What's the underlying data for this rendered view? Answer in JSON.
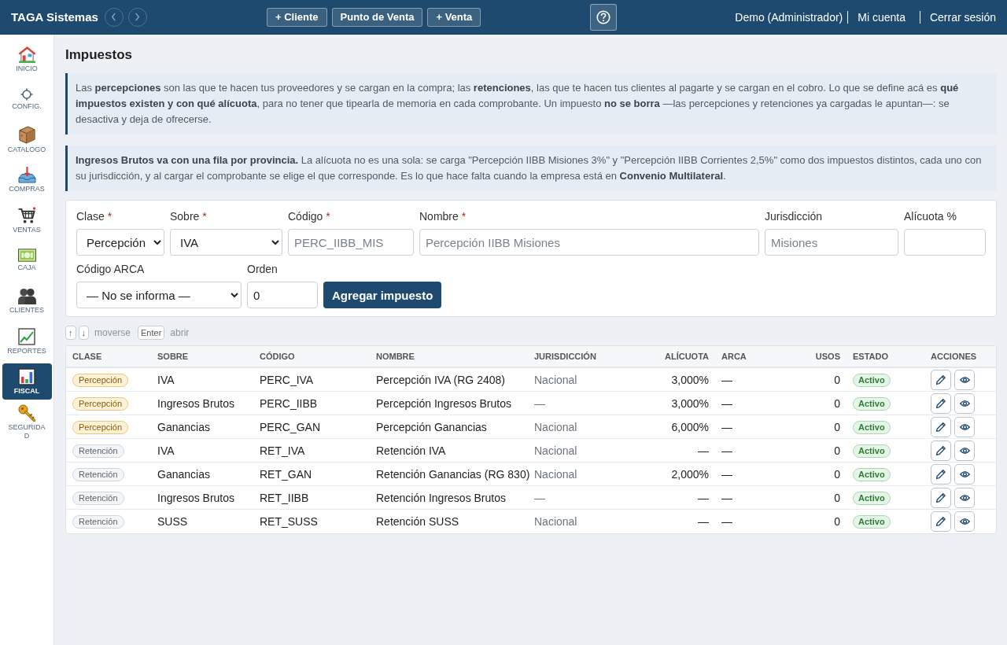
{
  "top_bar": {
    "brand": "TAGA Sistemas",
    "actions": [
      "+ Cliente",
      "Punto de Venta",
      "+ Venta"
    ],
    "user": "Demo (Administrador)",
    "links": [
      "Mi cuenta",
      "Cerrar sesión"
    ]
  },
  "sidebar": {
    "items": [
      {
        "label": "INICIO",
        "selected": false
      },
      {
        "label": "CONFIG.",
        "selected": false
      },
      {
        "label": "CATALOGO",
        "selected": false
      },
      {
        "label": "COMPRAS",
        "selected": false
      },
      {
        "label": "VENTAS",
        "selected": false
      },
      {
        "label": "CAJA",
        "selected": false
      },
      {
        "label": "CLIENTES",
        "selected": false
      },
      {
        "label": "REPORTES",
        "selected": false
      },
      {
        "label": "FISCAL",
        "selected": true
      },
      {
        "label": "SEGURIDAD",
        "selected": false
      }
    ]
  },
  "page": {
    "title": "Impuestos",
    "notes": [
      "Las **percepciones** son las que te hacen tus proveedores y se cargan en la compra; las **retenciones**, las que te hacen tus clientes al pagarte y se cargan en el cobro. Lo que se define acá es **qué impuestos existen y con qué alícuota**, para no tener que tipearla de memoria en cada comprobante. Un impuesto **no se borra** —las percepciones y retenciones ya cargadas le apuntan—: se desactiva y deja de ofrecerse.",
      "**Ingresos Brutos va con una fila por provincia.** La alícuota no es una sola: se carga \"Percepción IIBB Misiones 3%\" y \"Percepción IIBB Corrientes 2,5%\" como dos impuestos distintos, cada uno con su jurisdicción, y al cargar el comprobante se elige el que corresponde. Es lo que hace falta cuando la empresa está en **Convenio Multilateral**."
    ]
  },
  "form": {
    "rows": [
      [
        {
          "label": "Clase",
          "required_mark": "*",
          "kind": "select",
          "value": "Percepción"
        },
        {
          "label": "Sobre",
          "required_mark": "*",
          "kind": "select",
          "value": "IVA"
        },
        {
          "label": "Código",
          "required_mark": "*",
          "kind": "text",
          "placeholder": "PERC_IIBB_MIS"
        },
        {
          "label": "Nombre",
          "required_mark": "*",
          "kind": "text",
          "placeholder": "Percepción IIBB Misiones"
        },
        {
          "label": "Jurisdicción",
          "kind": "text",
          "placeholder": "Misiones"
        },
        {
          "label": "Alícuota %",
          "kind": "text"
        }
      ],
      [
        {
          "label": "Código ARCA",
          "kind": "select",
          "value": "— No se informa —"
        },
        {
          "label": "Orden",
          "kind": "text",
          "value": "0"
        }
      ]
    ],
    "submit": "Agregar impuesto"
  },
  "keyboard_hints": [
    {
      "keys": [
        "↑",
        "↓"
      ],
      "label": "moverse"
    },
    {
      "keys": [
        "Enter"
      ],
      "label": "abrir"
    }
  ],
  "table": {
    "columns": [
      "CLASE",
      "SOBRE",
      "CÓDIGO",
      "NOMBRE",
      "JURISDICCIÓN",
      "ALÍCUOTA",
      "ARCA",
      "USOS",
      "ESTADO",
      "ACCIONES"
    ],
    "rows": [
      {
        "kind": "percepcion",
        "clase": "Percepción",
        "sobre": "IVA",
        "codigo": "PERC_IVA",
        "nombre": "Percepción IVA (RG 2408)",
        "jurisdiccion": "Nacional",
        "alicuota": "3,000%",
        "arca": "—",
        "usos": "0",
        "estado": "Activo"
      },
      {
        "kind": "percepcion",
        "clase": "Percepción",
        "sobre": "Ingresos Brutos",
        "codigo": "PERC_IIBB",
        "nombre": "Percepción Ingresos Brutos",
        "jurisdiccion": "—",
        "alicuota": "3,000%",
        "arca": "—",
        "usos": "0",
        "estado": "Activo"
      },
      {
        "kind": "percepcion",
        "clase": "Percepción",
        "sobre": "Ganancias",
        "codigo": "PERC_GAN",
        "nombre": "Percepción Ganancias",
        "jurisdiccion": "Nacional",
        "alicuota": "6,000%",
        "arca": "—",
        "usos": "0",
        "estado": "Activo"
      },
      {
        "kind": "retencion",
        "clase": "Retención",
        "sobre": "IVA",
        "codigo": "RET_IVA",
        "nombre": "Retención IVA",
        "jurisdiccion": "Nacional",
        "alicuota": "—",
        "arca": "—",
        "usos": "0",
        "estado": "Activo"
      },
      {
        "kind": "retencion",
        "clase": "Retención",
        "sobre": "Ganancias",
        "codigo": "RET_GAN",
        "nombre": "Retención Ganancias (RG 830)",
        "jurisdiccion": "Nacional",
        "alicuota": "2,000%",
        "arca": "—",
        "usos": "0",
        "estado": "Activo"
      },
      {
        "kind": "retencion",
        "clase": "Retención",
        "sobre": "Ingresos Brutos",
        "codigo": "RET_IIBB",
        "nombre": "Retención Ingresos Brutos",
        "jurisdiccion": "—",
        "alicuota": "—",
        "arca": "—",
        "usos": "0",
        "estado": "Activo"
      },
      {
        "kind": "retencion",
        "clase": "Retención",
        "sobre": "SUSS",
        "codigo": "RET_SUSS",
        "nombre": "Retención SUSS",
        "jurisdiccion": "Nacional",
        "alicuota": "—",
        "arca": "—",
        "usos": "0",
        "estado": "Activo"
      }
    ]
  }
}
